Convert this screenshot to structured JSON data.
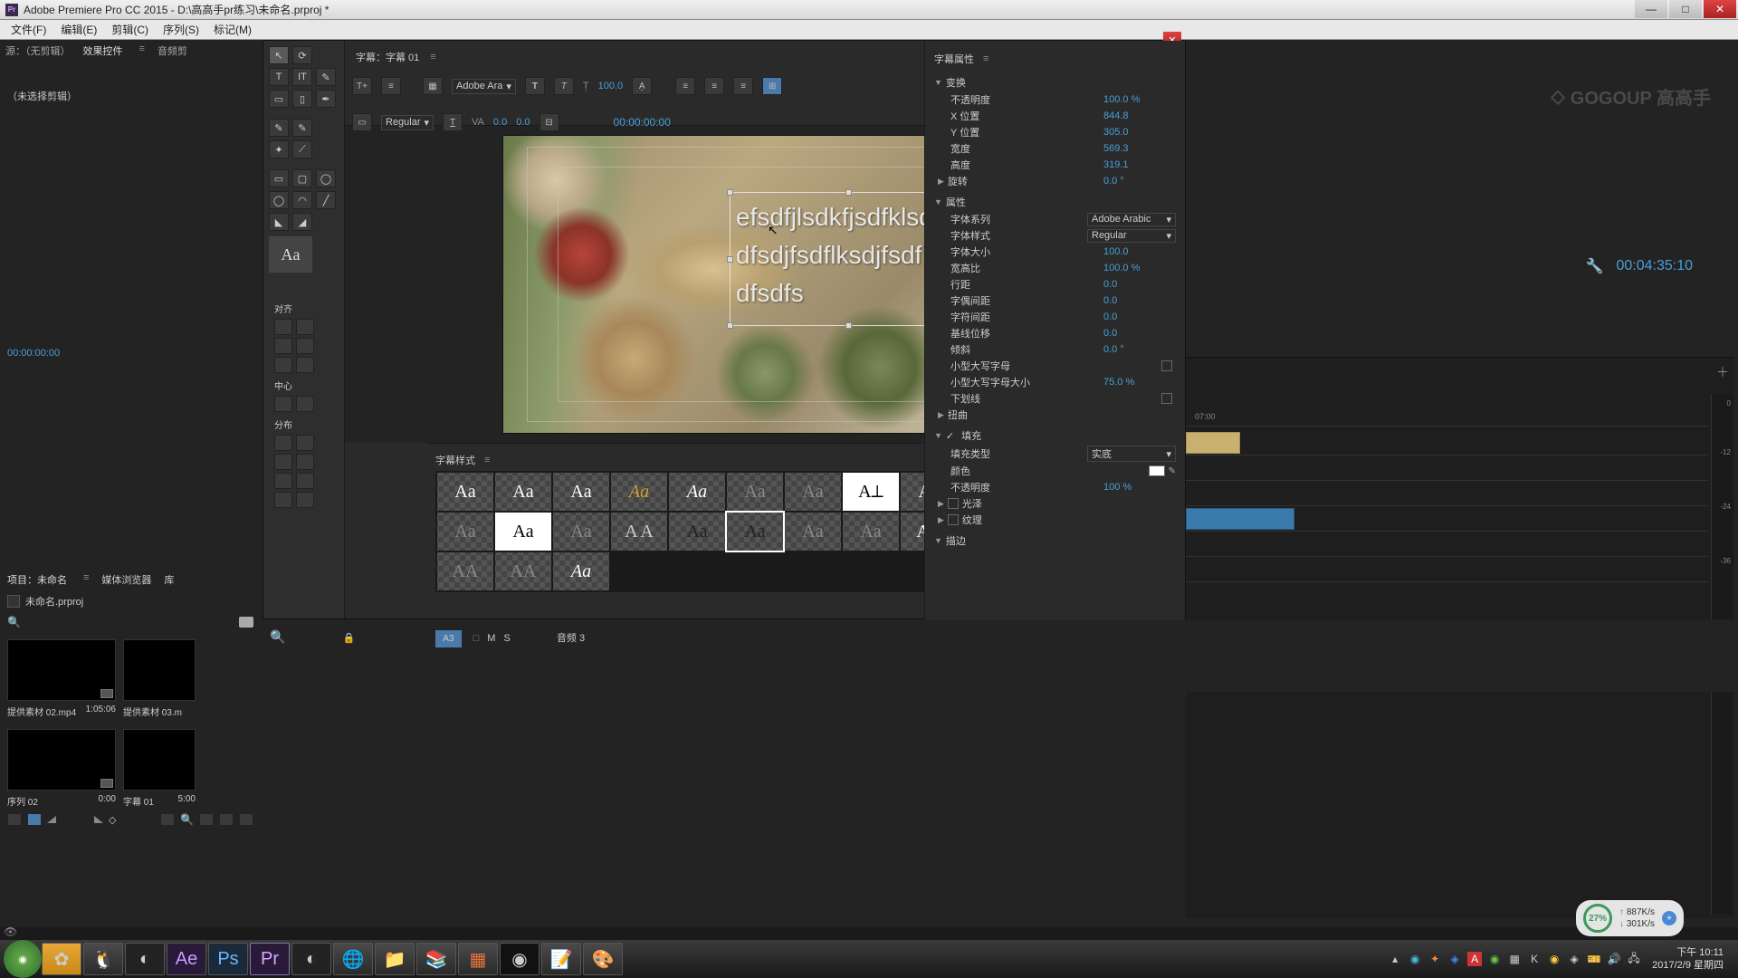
{
  "app": {
    "title": "Adobe Premiere Pro CC 2015 - D:\\高高手pr练习\\未命名.prproj *",
    "icon_label": "Pr"
  },
  "win_buttons": {
    "min": "—",
    "max": "□",
    "close": "✕"
  },
  "menu": [
    "文件(F)",
    "编辑(E)",
    "剪辑(C)",
    "序列(S)",
    "标记(M)"
  ],
  "source_panel": {
    "tabs": [
      "源：（无剪辑）",
      "效果控件",
      "音频剪"
    ],
    "placeholder": "（未选择剪辑）"
  },
  "project_panel": {
    "tabs": [
      "项目：未命名",
      "媒体浏览器",
      "库"
    ],
    "file": "未命名.prproj",
    "items": [
      {
        "name": "提供素材 02.mp4",
        "dur": "1:05:06"
      },
      {
        "name": "提供素材 03.m",
        "dur": ""
      },
      {
        "name": "序列 02",
        "dur": "0:00"
      },
      {
        "name": "字幕 01",
        "dur": "5:00"
      }
    ],
    "timecode": "00:00:00:00"
  },
  "title_window": {
    "title": "字幕：字幕 01",
    "font_family": "Adobe Ara",
    "font_style": "Regular",
    "font_size": "100.0",
    "kerning": "0.0",
    "tracking": "0.0",
    "timecode": "00:00:00:00",
    "text_lines": [
      "efsdfjlsdkfjsdfklsdjfs",
      "dfsdjfsdflksdjfsdf",
      "dfsdfs"
    ],
    "align_label": "对齐",
    "center_label": "中心",
    "distribute_label": "分布",
    "styles_label": "字幕样式"
  },
  "properties": {
    "header": "字幕属性",
    "transform": {
      "label": "变换",
      "opacity_label": "不透明度",
      "opacity": "100.0 %",
      "x_label": "X 位置",
      "x": "844.8",
      "y_label": "Y 位置",
      "y": "305.0",
      "w_label": "宽度",
      "w": "569.3",
      "h_label": "高度",
      "h": "319.1",
      "rot_label": "旋转",
      "rot": "0.0 °"
    },
    "attrs": {
      "label": "属性",
      "family_label": "字体系列",
      "family": "Adobe Arabic",
      "style_label": "字体样式",
      "style": "Regular",
      "size_label": "字体大小",
      "size": "100.0",
      "aspect_label": "宽高比",
      "aspect": "100.0 %",
      "leading_label": "行距",
      "leading": "0.0",
      "kerning_label": "字偶间距",
      "kerning": "0.0",
      "tracking_label": "字符间距",
      "tracking": "0.0",
      "baseline_label": "基线位移",
      "baseline": "0.0",
      "slant_label": "倾斜",
      "slant": "0.0 °",
      "smallcaps_label": "小型大写字母",
      "smallcaps_size_label": "小型大写字母大小",
      "smallcaps_size": "75.0 %",
      "underline_label": "下划线",
      "distort_label": "扭曲"
    },
    "fill": {
      "label": "填充",
      "type_label": "填充类型",
      "type": "实底",
      "color_label": "颜色",
      "opacity_label": "不透明度",
      "opacity": "100 %",
      "sheen_label": "光泽",
      "texture_label": "纹理"
    },
    "stroke_label": "描边"
  },
  "right_area": {
    "watermark": "GOGOUP 高高手",
    "big_timecode": "00:04:35:10",
    "ruler_mark": "07:00"
  },
  "timeline_bottom": {
    "track_btn": "A3",
    "track_labels": [
      "M",
      "S"
    ],
    "track_name": "音频 3"
  },
  "net": {
    "pct": "27%",
    "up": "887K/s",
    "down": "301K/s"
  },
  "clock": {
    "time": "下午 10:11",
    "date": "2017/2/9 星期四"
  },
  "taskbar_apps": [
    "Start",
    "Share",
    "QQ",
    "C4D",
    "Ae",
    "Ps",
    "Pr",
    "C4D2",
    "Chrome",
    "Explorer",
    "WinRAR",
    "PPT",
    "Obs",
    "Notes",
    "Paint"
  ]
}
